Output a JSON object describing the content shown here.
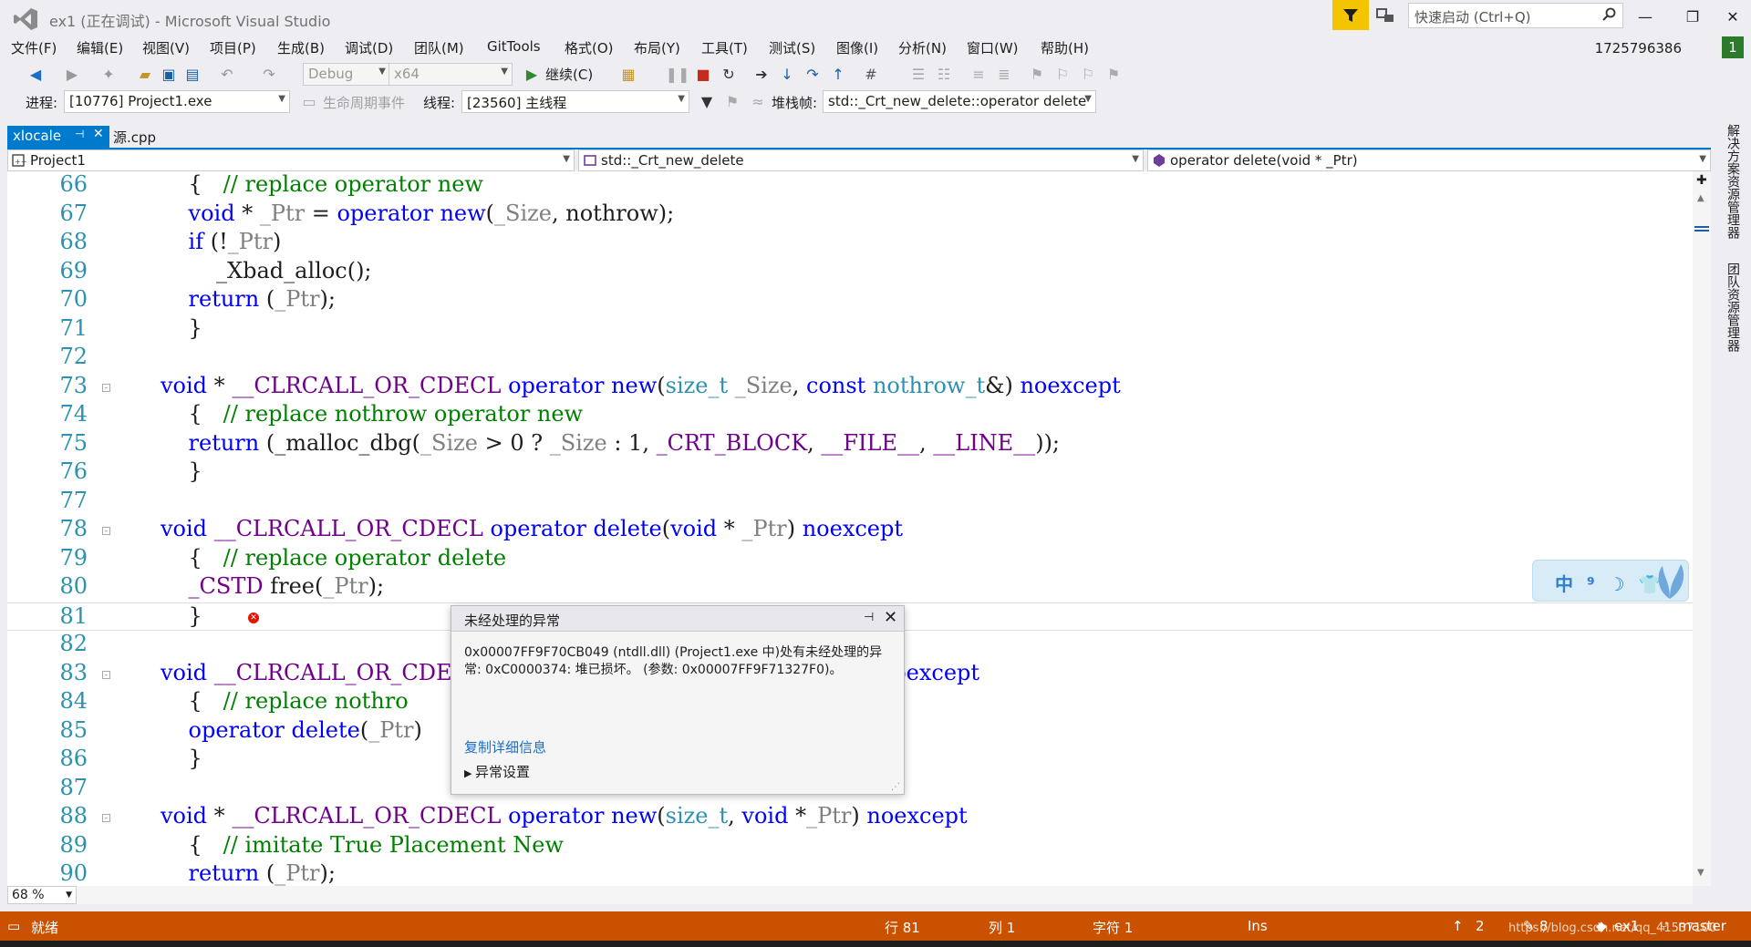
{
  "window": {
    "title": "ex1 (正在调试) - Microsoft Visual Studio",
    "quick_launch_placeholder": "快速启动 (Ctrl+Q)",
    "user_id": "1725796386",
    "user_badge": "1",
    "minimize": "—",
    "maximize": "❐",
    "close": "✕"
  },
  "menu": [
    "文件(F)",
    "编辑(E)",
    "视图(V)",
    "项目(P)",
    "生成(B)",
    "调试(D)",
    "团队(M)",
    "GitTools",
    "格式(O)",
    "布局(Y)",
    "工具(T)",
    "测试(S)",
    "图像(I)",
    "分析(N)",
    "窗口(W)",
    "帮助(H)"
  ],
  "toolbar": {
    "config": "Debug",
    "platform": "x64",
    "continue_label": "继续(C)"
  },
  "debug_location": {
    "process_label": "进程:",
    "process_value": "[10776] Project1.exe",
    "lifecycle_label": "生命周期事件",
    "thread_label": "线程:",
    "thread_value": "[23560] 主线程",
    "stackframe_label": "堆栈帧:",
    "stackframe_value": "std::_Crt_new_delete::operator delete"
  },
  "tabs": {
    "active": "xlocale",
    "inactive": "源.cpp"
  },
  "nav": {
    "project": "Project1",
    "scope": "std::_Crt_new_delete",
    "member": "operator delete(void * _Ptr)"
  },
  "code_lines": [
    {
      "n": "66"
    },
    {
      "n": "67"
    },
    {
      "n": "68"
    },
    {
      "n": "69"
    },
    {
      "n": "70"
    },
    {
      "n": "71"
    },
    {
      "n": "72"
    },
    {
      "n": "73"
    },
    {
      "n": "74"
    },
    {
      "n": "75"
    },
    {
      "n": "76"
    },
    {
      "n": "77"
    },
    {
      "n": "78"
    },
    {
      "n": "79"
    },
    {
      "n": "80"
    },
    {
      "n": "81"
    },
    {
      "n": "82"
    },
    {
      "n": "83"
    },
    {
      "n": "84"
    },
    {
      "n": "85"
    },
    {
      "n": "86"
    },
    {
      "n": "87"
    },
    {
      "n": "88"
    },
    {
      "n": "89"
    },
    {
      "n": "90"
    }
  ],
  "exception": {
    "title": "未经处理的异常",
    "message": "0x00007FF9F70CB049 (ntdll.dll) (Project1.exe 中)处有未经处理的异常: 0xC0000374: 堆已损坏。 (参数: 0x00007FF9F71327F0)。",
    "copy_link": "复制详细信息",
    "settings": "异常设置"
  },
  "ime": {
    "text": "中 ⁹ ☽ 👕"
  },
  "right_tabs": [
    "解决方案资源管理器",
    "团队资源管理器"
  ],
  "zoom": "68 %",
  "status": {
    "state": "就绪",
    "line": "行 81",
    "col": "列 1",
    "ch": "字符 1",
    "mode": "Ins",
    "push": "2",
    "changes": "8",
    "repo": "ex1",
    "branch": "master",
    "watermark": "https://blog.csdn.net/qq_41537100"
  },
  "colors": {
    "accent": "#007acc",
    "status_bar": "#ca5100",
    "filter_btn": "#f5c400",
    "keyword": "#0000ff",
    "comment": "#008000",
    "macro": "#6f008a",
    "line_number": "#2b91af"
  }
}
